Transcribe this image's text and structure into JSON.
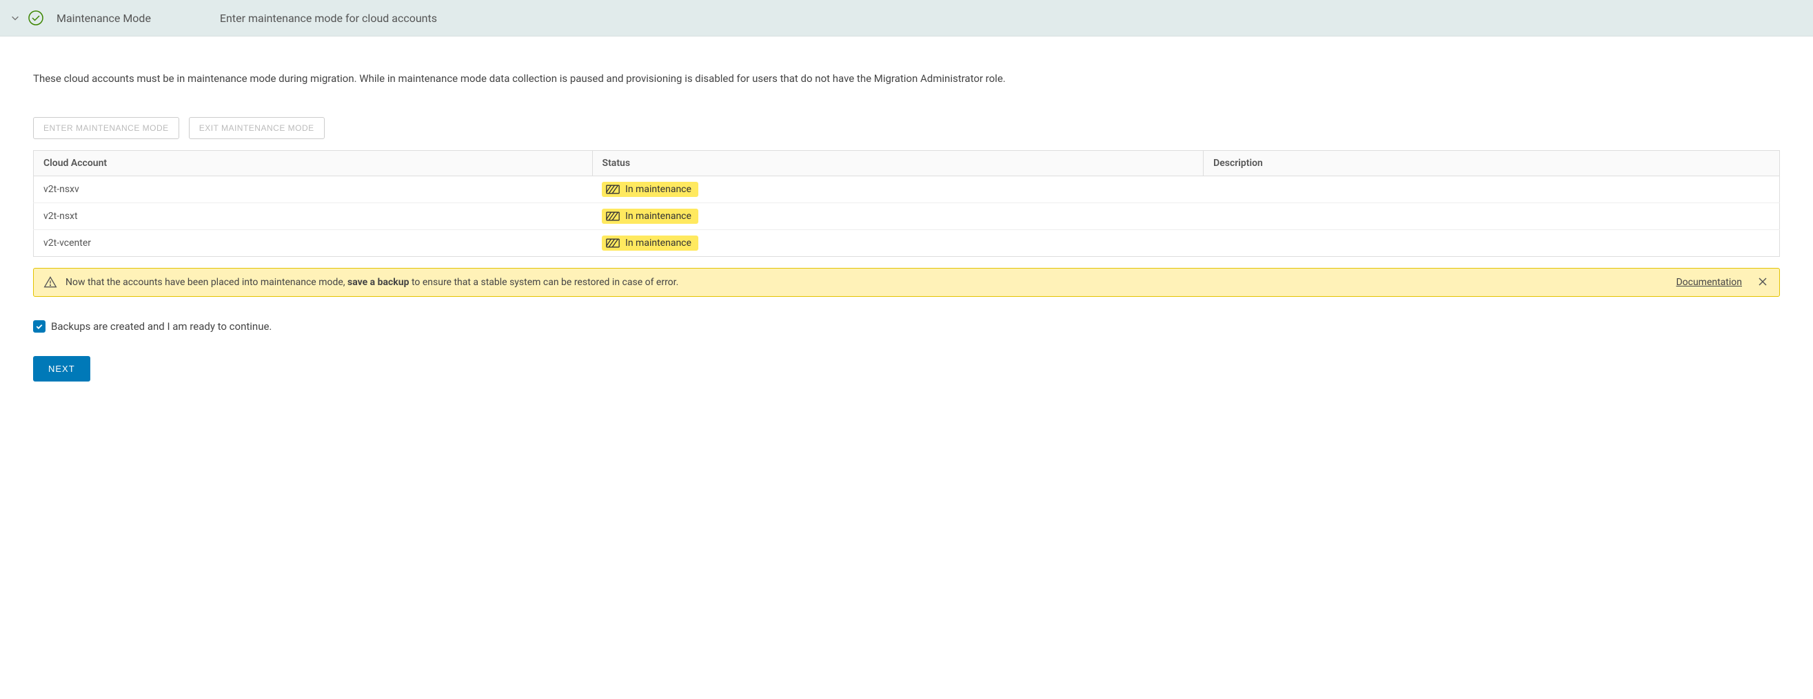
{
  "header": {
    "title": "Maintenance Mode",
    "subtitle": "Enter maintenance mode for cloud accounts"
  },
  "intro": "These cloud accounts must be in maintenance mode during migration. While in maintenance mode data collection is paused and provisioning is disabled for users that do not have the Migration Administrator role.",
  "buttons": {
    "enter": "ENTER MAINTENANCE MODE",
    "exit": "EXIT MAINTENANCE MODE",
    "next": "NEXT"
  },
  "table": {
    "headers": {
      "account": "Cloud Account",
      "status": "Status",
      "description": "Description"
    },
    "rows": [
      {
        "account": "v2t-nsxv",
        "status": "In maintenance",
        "description": ""
      },
      {
        "account": "v2t-nsxt",
        "status": "In maintenance",
        "description": ""
      },
      {
        "account": "v2t-vcenter",
        "status": "In maintenance",
        "description": ""
      }
    ]
  },
  "alert": {
    "prefix": "Now that the accounts have been placed into maintenance mode, ",
    "strong": "save a backup",
    "suffix": " to ensure that a stable system can be restored in case of error.",
    "link": "Documentation"
  },
  "checkbox": {
    "label": "Backups are created and I am ready to continue.",
    "checked": true
  }
}
